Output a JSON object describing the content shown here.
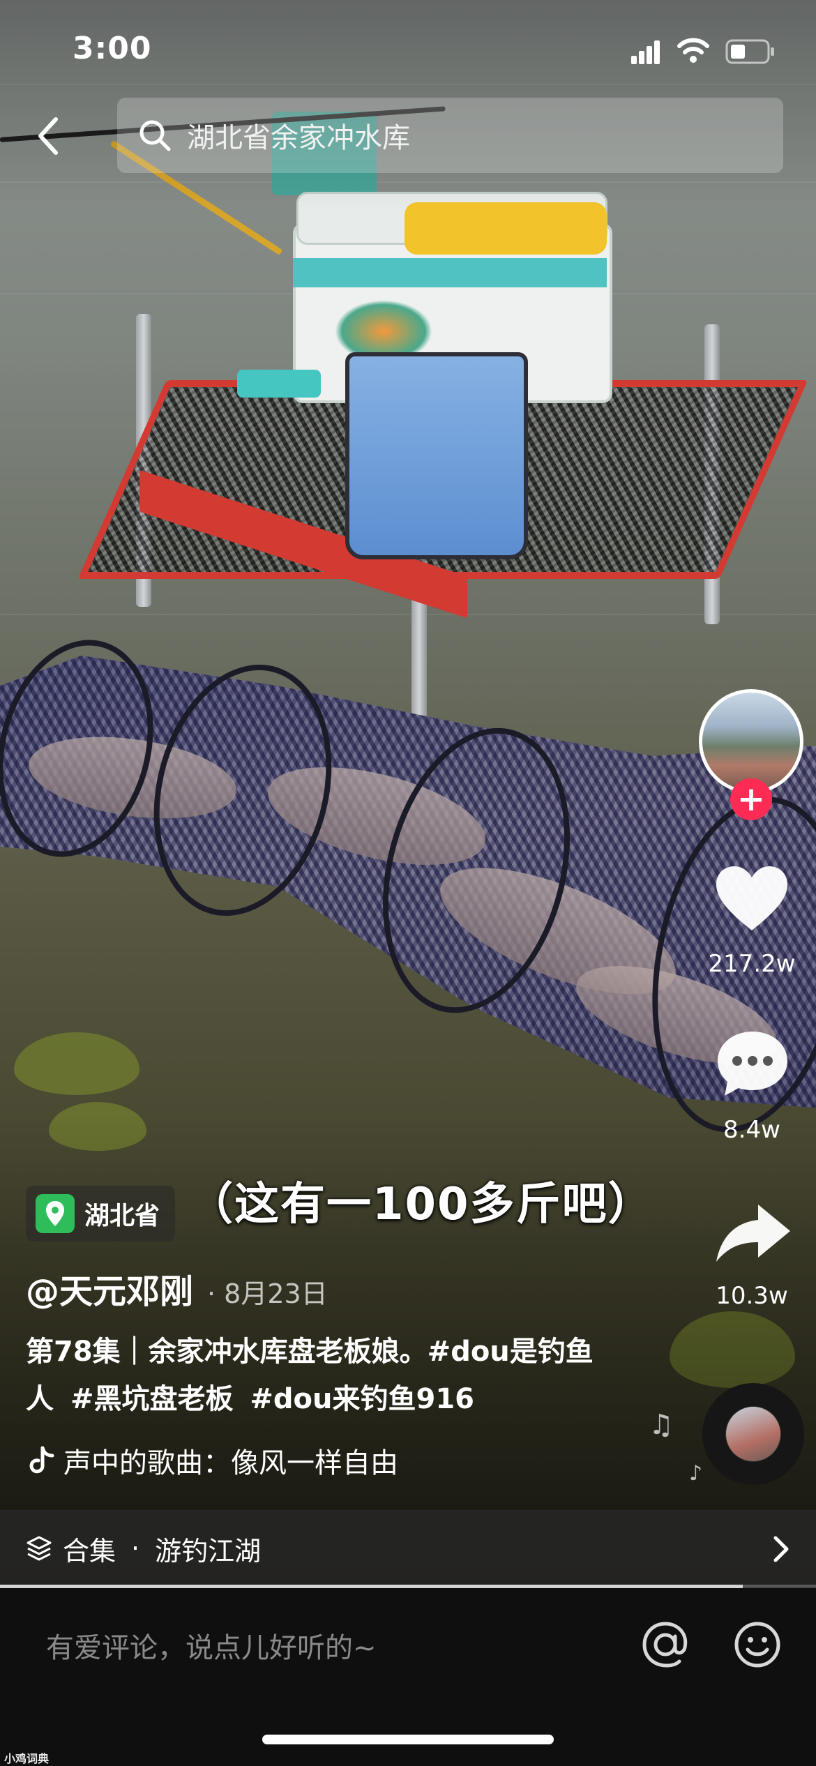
{
  "status_bar": {
    "time": "3:00",
    "icons": [
      "signal-icon",
      "wifi-icon",
      "battery-icon"
    ]
  },
  "search": {
    "query": "湖北省余家冲水库",
    "icons": [
      "back-icon",
      "search-icon"
    ]
  },
  "video": {
    "subtitle": "（这有一100多斤吧）",
    "progress": 0.91
  },
  "rail": {
    "likes": "217.2w",
    "comments": "8.4w",
    "shares": "10.3w",
    "follow_label": "+"
  },
  "post": {
    "location": "湖北省",
    "author": "@天元邓刚",
    "date": "· 8月23日",
    "caption_prefix": "第78集｜余家冲水库盘老板娘。",
    "hashtags": [
      "#dou是钓鱼人",
      "#黑坑盘老板",
      "#dou来钓鱼916"
    ],
    "music": "声中的歌曲：像风一样自由"
  },
  "collection": {
    "label": "合集",
    "dot": "·",
    "name": "游钓江湖"
  },
  "comment_bar": {
    "placeholder": "有爱评论，说点儿好听的~"
  },
  "watermark": "小鸡词典",
  "colors": {
    "accent": "#fe2c55",
    "location_green": "#2fbd5c"
  }
}
